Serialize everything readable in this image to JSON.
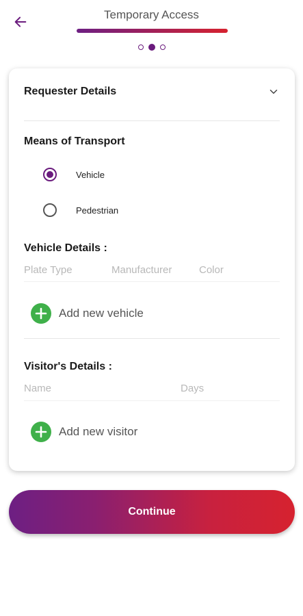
{
  "header": {
    "title": "Temporary Access",
    "back_icon": "arrow-left-icon",
    "underline_gradient": [
      "#6d1f83",
      "#d6222f"
    ],
    "steps_total": 3,
    "current_step": 2
  },
  "card": {
    "requester_section": {
      "label": "Requester Details",
      "expanded": false,
      "icon": "chevron-down-icon"
    },
    "transport": {
      "label": "Means of Transport",
      "options": [
        {
          "label": "Vehicle",
          "selected": true
        },
        {
          "label": "Pedestrian",
          "selected": false
        }
      ]
    },
    "vehicle_details": {
      "label": "Vehicle Details :",
      "columns": [
        "Plate Type",
        "Manufacturer",
        "Color"
      ],
      "add_label": "Add new vehicle",
      "add_icon": "plus-circle-icon"
    },
    "visitor_details": {
      "label": "Visitor's Details :",
      "columns": [
        "Name",
        "Days"
      ],
      "add_label": "Add new visitor",
      "add_icon": "plus-circle-icon"
    }
  },
  "continue_button": {
    "label": "Continue"
  },
  "colors": {
    "accent_purple": "#6a1b7d",
    "accent_red": "#d6222f",
    "add_green": "#3fb04a",
    "placeholder_gray": "#b8b8b8"
  }
}
